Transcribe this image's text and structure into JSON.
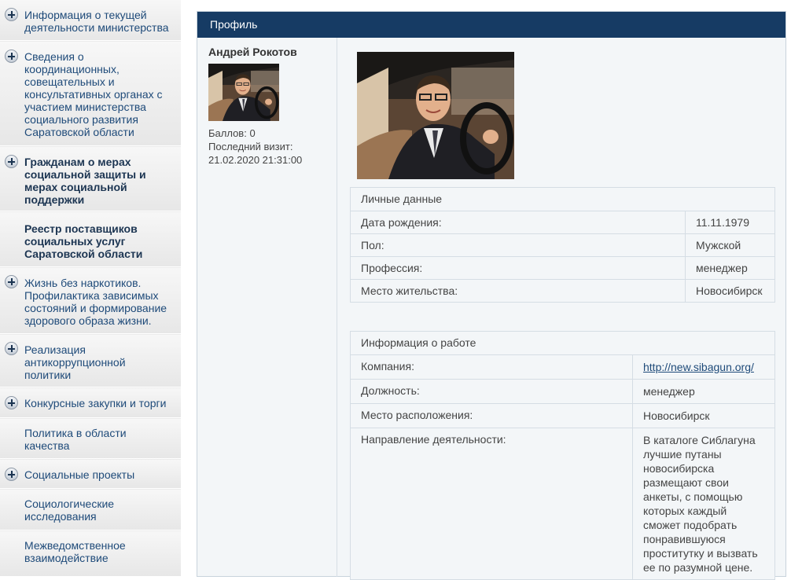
{
  "sidebar": {
    "items": [
      {
        "label": "Информация о текущей деятельности министерства",
        "plus": true,
        "bold": false
      },
      {
        "label": "Сведения о координационных, совещательных и консультативных органах с участием министерства социального развития Саратовской области",
        "plus": true,
        "bold": false
      },
      {
        "label": "Гражданам о мерах социальной защиты и мерах социальной поддержки",
        "plus": true,
        "bold": true
      },
      {
        "label": "Реестр поставщиков социальных услуг Саратовской области",
        "plus": false,
        "bold": true
      },
      {
        "label": "Жизнь без наркотиков. Профилактика зависимых состояний и формирование здорового образа жизни.",
        "plus": true,
        "bold": false
      },
      {
        "label": "Реализация антикоррупционной политики",
        "plus": true,
        "bold": false
      },
      {
        "label": "Конкурсные закупки и торги",
        "plus": true,
        "bold": false
      },
      {
        "label": "Политика в области качества",
        "plus": false,
        "bold": false
      },
      {
        "label": "Социальные проекты",
        "plus": true,
        "bold": false
      },
      {
        "label": "Социологические исследования",
        "plus": false,
        "bold": false
      },
      {
        "label": "Межведомственное взаимодействие",
        "plus": false,
        "bold": false
      }
    ]
  },
  "profile": {
    "header": "Профиль",
    "name": "Андрей Рокотов",
    "points": "Баллов: 0",
    "last_visit_label": "Последний визит:",
    "last_visit_value": "21.02.2020 21:31:00"
  },
  "personal": {
    "title": "Личные данные",
    "rows": [
      {
        "label": "Дата рождения:",
        "value": "11.11.1979"
      },
      {
        "label": "Пол:",
        "value": "Мужской"
      },
      {
        "label": "Профессия:",
        "value": "менеджер"
      },
      {
        "label": "Место жительства:",
        "value": "Новосибирск"
      }
    ]
  },
  "work": {
    "title": "Информация о работе",
    "rows": [
      {
        "label": "Компания:",
        "value": "http://new.sibagun.org/",
        "link": true
      },
      {
        "label": "Должность:",
        "value": "менеджер",
        "link": false
      },
      {
        "label": "Место расположения:",
        "value": "Новосибирск",
        "link": false
      },
      {
        "label": "Направление деятельности:",
        "value": "В каталоге Сиблагуна лучшие путаны новосибирска размещают свои анкеты, с помощью которых каждый сможет подобрать понравившуюся проститутку и вызвать ее по разумной цене.",
        "link": false
      }
    ]
  },
  "colors": {
    "header_bg": "#163b64",
    "link": "#1e4a79",
    "sidebar_text": "#1e4a79"
  }
}
